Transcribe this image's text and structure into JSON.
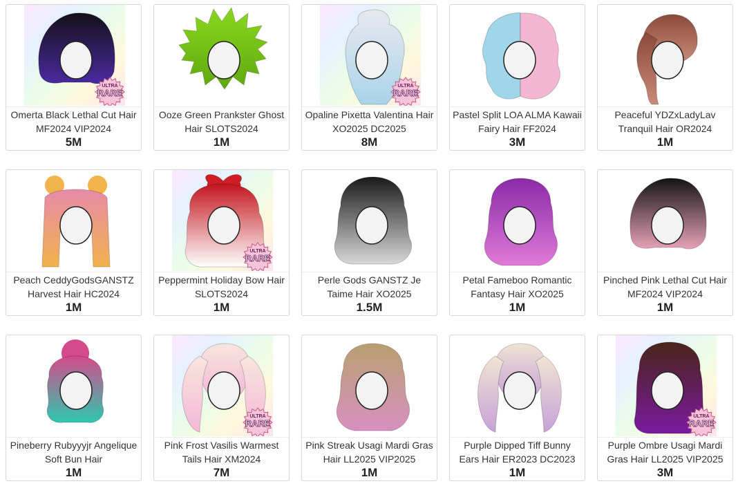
{
  "items": [
    {
      "name": "Omerta Black Lethal Cut Hair MF2024 VIP2024",
      "price": "5M",
      "hair_color": "#141018",
      "accent_color": "#4a2aa0",
      "style": "bob",
      "rainbow_bg": true,
      "badge": {
        "top": "ULTRA",
        "main": "RARE"
      }
    },
    {
      "name": "Ooze Green Prankster Ghost Hair SLOTS2024",
      "price": "1M",
      "hair_color": "#8ad81f",
      "accent_color": "#5ea80e",
      "style": "spiky",
      "rainbow_bg": false,
      "badge": null
    },
    {
      "name": "Opaline Pixetta Valentina Hair XO2025 DC2025",
      "price": "8M",
      "hair_color": "#e8e8ee",
      "accent_color": "#a9d4ea",
      "style": "updo-long",
      "rainbow_bg": true,
      "badge": {
        "top": "ULTRA",
        "main": "RARE"
      }
    },
    {
      "name": "Pastel Split LOA ALMA Kawaii Fairy Hair FF2024",
      "price": "3M",
      "hair_color": "#9fd6ea",
      "accent_color": "#f4b6d0",
      "style": "wavy-split",
      "rainbow_bg": false,
      "badge": null
    },
    {
      "name": "Peaceful YDZxLadyLav Tranquil Hair OR2024",
      "price": "1M",
      "hair_color": "#8a4a3c",
      "accent_color": "#c98b78",
      "style": "ponytail",
      "rainbow_bg": false,
      "badge": null
    },
    {
      "name": "Peach CeddyGodsGANSTZ Harvest Hair HC2024",
      "price": "1M",
      "hair_color": "#e88aa8",
      "accent_color": "#f2b24c",
      "style": "buns-straight",
      "rainbow_bg": false,
      "badge": null
    },
    {
      "name": "Peppermint Holiday Bow Hair SLOTS2024",
      "price": "1M",
      "hair_color": "#c2161e",
      "accent_color": "#ffffff",
      "style": "bow-curly",
      "rainbow_bg": true,
      "badge": {
        "top": "ULTRA",
        "main": "RARE"
      }
    },
    {
      "name": "Perle Gods GANSTZ Je Taime Hair XO2025",
      "price": "1.5M",
      "hair_color": "#1a1a1a",
      "accent_color": "#d8d8d8",
      "style": "curly-ombre",
      "rainbow_bg": false,
      "badge": null
    },
    {
      "name": "Petal Fameboo Romantic Fantasy Hair XO2025",
      "price": "1M",
      "hair_color": "#8a2aa8",
      "accent_color": "#e07ad8",
      "style": "wavy",
      "rainbow_bg": false,
      "badge": null
    },
    {
      "name": "Pinched Pink Lethal Cut Hair MF2024 VIP2024",
      "price": "1M",
      "hair_color": "#141414",
      "accent_color": "#e8a2b8",
      "style": "bob",
      "rainbow_bg": false,
      "badge": null
    },
    {
      "name": "Pineberry Rubyyyjr Angelique Soft Bun Hair",
      "price": "1M",
      "hair_color": "#d44a8a",
      "accent_color": "#2ec8b0",
      "style": "bun-curls",
      "rainbow_bg": false,
      "badge": null
    },
    {
      "name": "Pink Frost Vasilis Warmest Tails Hair XM2024",
      "price": "7M",
      "hair_color": "#f8e6de",
      "accent_color": "#f4b8d8",
      "style": "twintails",
      "rainbow_bg": true,
      "badge": {
        "top": "ULTRA",
        "main": "RARE"
      }
    },
    {
      "name": "Pink Streak Usagi Mardi Gras Hair LL2025 VIP2025",
      "price": "1M",
      "hair_color": "#b8a070",
      "accent_color": "#d890c0",
      "style": "wavy",
      "rainbow_bg": false,
      "badge": null
    },
    {
      "name": "Purple Dipped Tiff Bunny Ears Hair ER2023 DC2023",
      "price": "1M",
      "hair_color": "#efe4d4",
      "accent_color": "#c8a2d8",
      "style": "twintails",
      "rainbow_bg": false,
      "badge": null
    },
    {
      "name": "Purple Ombre Usagi Mardi Gras Hair LL2025 VIP2025",
      "price": "3M",
      "hair_color": "#4a2418",
      "accent_color": "#7a1aa0",
      "style": "long",
      "rainbow_bg": true,
      "badge": {
        "top": "ULTRA",
        "main": "RARE"
      }
    }
  ]
}
